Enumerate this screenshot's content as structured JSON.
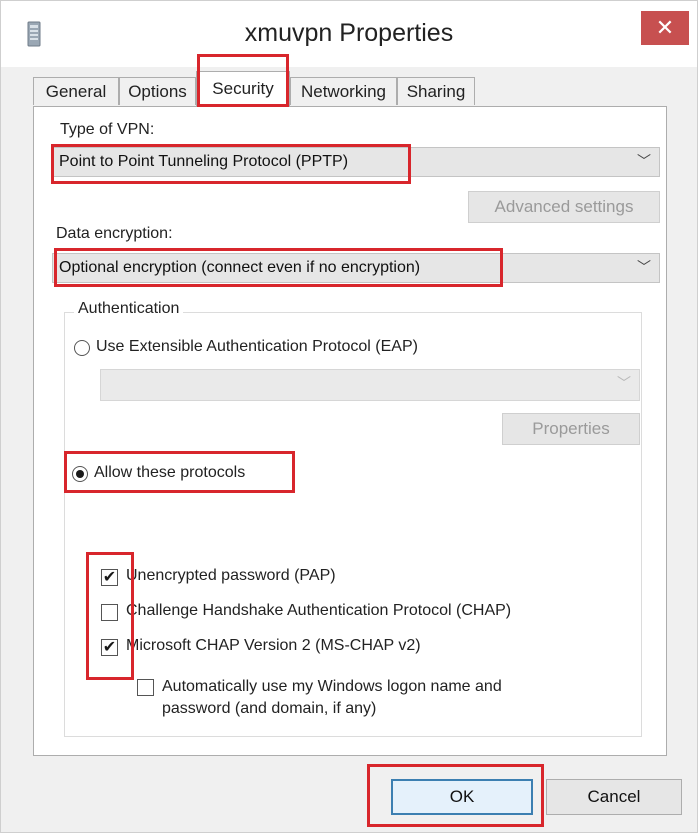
{
  "window": {
    "title": "xmuvpn Properties",
    "close_glyph": "✕",
    "app_icon": "phone-book-icon"
  },
  "tabs": [
    {
      "label": "General",
      "active": false
    },
    {
      "label": "Options",
      "active": false
    },
    {
      "label": "Security",
      "active": true
    },
    {
      "label": "Networking",
      "active": false
    },
    {
      "label": "Sharing",
      "active": false
    }
  ],
  "security": {
    "vpn_type_label": "Type of VPN:",
    "vpn_type_value": "Point to Point Tunneling Protocol (PPTP)",
    "advanced_settings_label": "Advanced settings",
    "data_encryption_label": "Data encryption:",
    "data_encryption_value": "Optional encryption (connect even if no encryption)",
    "authentication": {
      "legend": "Authentication",
      "eap_label": "Use Extensible Authentication Protocol (EAP)",
      "eap_selected": false,
      "eap_combo_value": "",
      "properties_label": "Properties",
      "allow_protocols_label": "Allow these protocols",
      "allow_protocols_selected": true,
      "protocols": [
        {
          "label": "Unencrypted password (PAP)",
          "checked": true
        },
        {
          "label": "Challenge Handshake Authentication Protocol (CHAP)",
          "checked": false
        },
        {
          "label": "Microsoft CHAP Version 2 (MS-CHAP v2)",
          "checked": true
        }
      ],
      "auto_logon_label_line1": "Automatically use my Windows logon name and",
      "auto_logon_label_line2": "password (and domain, if any)",
      "auto_logon_checked": false
    }
  },
  "footer": {
    "ok_label": "OK",
    "cancel_label": "Cancel"
  },
  "colors": {
    "highlight": "#d8262c",
    "close_button": "#c75050",
    "default_button_border": "#3c7fb1"
  },
  "glyphs": {
    "dropdown_arrow": "﹀",
    "check": "✔"
  }
}
